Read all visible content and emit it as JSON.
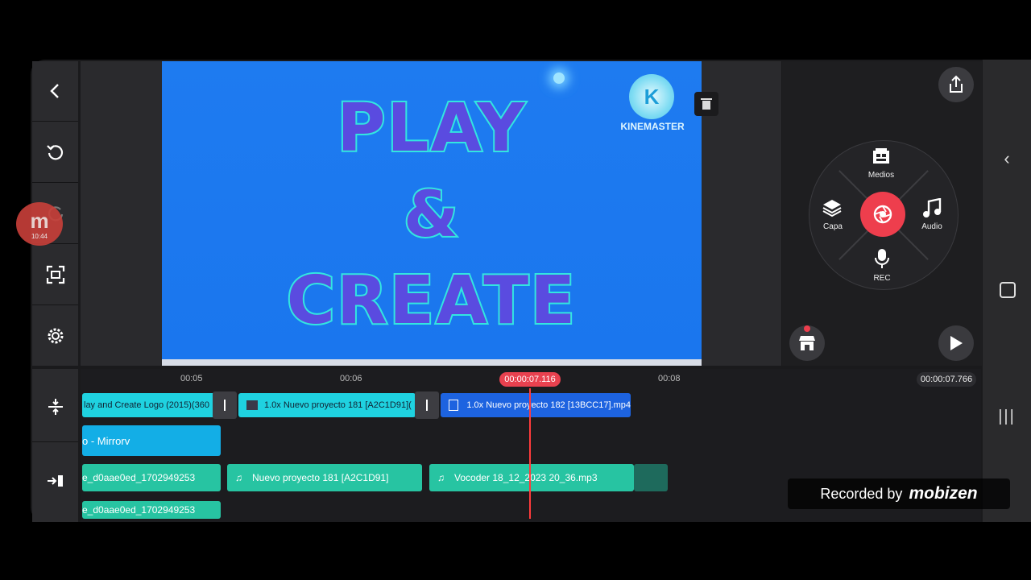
{
  "preview": {
    "line1": "PLAY",
    "line2": "&",
    "line3": "CREATE",
    "logo_text": "KINEMASTER"
  },
  "wheel": {
    "medios": "Medios",
    "capa": "Capa",
    "audio": "Audio",
    "rec": "REC"
  },
  "timeline": {
    "ticks": [
      "00:05",
      "00:06",
      "00:08"
    ],
    "current_time": "00:00:07.116",
    "end_time": "00:00:07.766",
    "video_clips": [
      "lay and Create Logo (2015)(360",
      "1.0x Nuevo proyecto 181 [A2C1D91](",
      "1.0x Nuevo proyecto 182 [13BCC17].mp4"
    ],
    "text_layer": "o - Mirrorv",
    "audio_row1": [
      "e_d0aae0ed_1702949253",
      "Nuevo proyecto 181 [A2C1D91]",
      "Vocoder 18_12_2023 20_36.mp3"
    ],
    "audio_row2": "e_d0aae0ed_1702949253"
  },
  "overlay": {
    "mobizen_time": "10:44",
    "recorded_by": "Recorded by",
    "brand": "mobizen"
  },
  "colors": {
    "preview_bg": "#1a76ee",
    "rec_red": "#ee3e4d",
    "video_clip": "#1fd2e0",
    "selected_clip": "#1d63e0",
    "audio_clip": "#27c4a2"
  }
}
